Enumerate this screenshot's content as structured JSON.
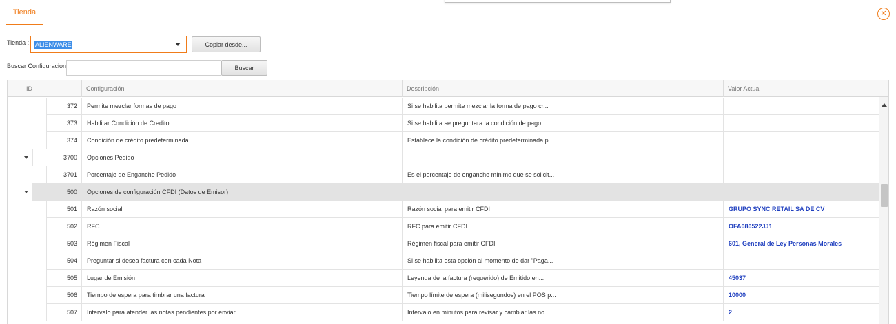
{
  "tab": {
    "label": "Tienda"
  },
  "close_icon": "close-circle-icon",
  "store": {
    "label": "Tienda :",
    "value": "ALIENWARE"
  },
  "copy_button": "Copiar desde...",
  "search": {
    "label": "Buscar Configuracion:",
    "value": "",
    "button": "Buscar"
  },
  "grid": {
    "columns": [
      "ID",
      "Configuración",
      "Descripción",
      "Valor Actual"
    ],
    "rows": [
      {
        "id": "372",
        "config": "Permite mezclar formas de pago",
        "desc": "Si se habilita permite mezclar la forma de pago cr...",
        "value": ""
      },
      {
        "id": "373",
        "config": "Habilitar Condición de Credito",
        "desc": "Si se habilita se preguntara la condición de pago ...",
        "value": ""
      },
      {
        "id": "374",
        "config": "Condición de crédito predeterminada",
        "desc": "Establece la condición de crédito predeterminada p...",
        "value": ""
      },
      {
        "id": "3700",
        "config": "Opciones Pedido",
        "desc": "",
        "value": ""
      },
      {
        "id": "3701",
        "config": "Porcentaje de Enganche Pedido",
        "desc": "Es el porcentaje de enganche mínimo que se solicit...",
        "value": ""
      },
      {
        "id": "500",
        "config": "Opciones de configuración CFDI (Datos de Emisor)",
        "desc": "",
        "value": ""
      },
      {
        "id": "501",
        "config": "Razón social",
        "desc": "Razón social para emitir CFDI",
        "value": "GRUPO SYNC RETAIL SA DE CV"
      },
      {
        "id": "502",
        "config": "RFC",
        "desc": "RFC para emitir CFDI",
        "value": "OFA080522JJ1"
      },
      {
        "id": "503",
        "config": "Régimen Fiscal",
        "desc": "Régimen fiscal para emitir CFDI",
        "value": "601, General de Ley Personas Morales"
      },
      {
        "id": "504",
        "config": "Preguntar si desea factura con cada Nota",
        "desc": "Si se habilita esta opción al momento de dar \"Paga...",
        "value": ""
      },
      {
        "id": "505",
        "config": "Lugar de Emisión",
        "desc": "Leyenda de la factura (requerido) de Emitido en...",
        "value": "45037"
      },
      {
        "id": "506",
        "config": "Tiempo de espera para timbrar una factura",
        "desc": "Tiempo límite de espera (milisegundos) en el POS p...",
        "value": "10000"
      },
      {
        "id": "507",
        "config": "Intervalo para atender las notas pendientes por enviar",
        "desc": "Intervalo en minutos para revisar y cambiar las no...",
        "value": "2"
      }
    ]
  },
  "colors": {
    "accent": "#f07c1a",
    "value_text": "#1f3fbf",
    "selected_row": "#e3e3e3"
  }
}
